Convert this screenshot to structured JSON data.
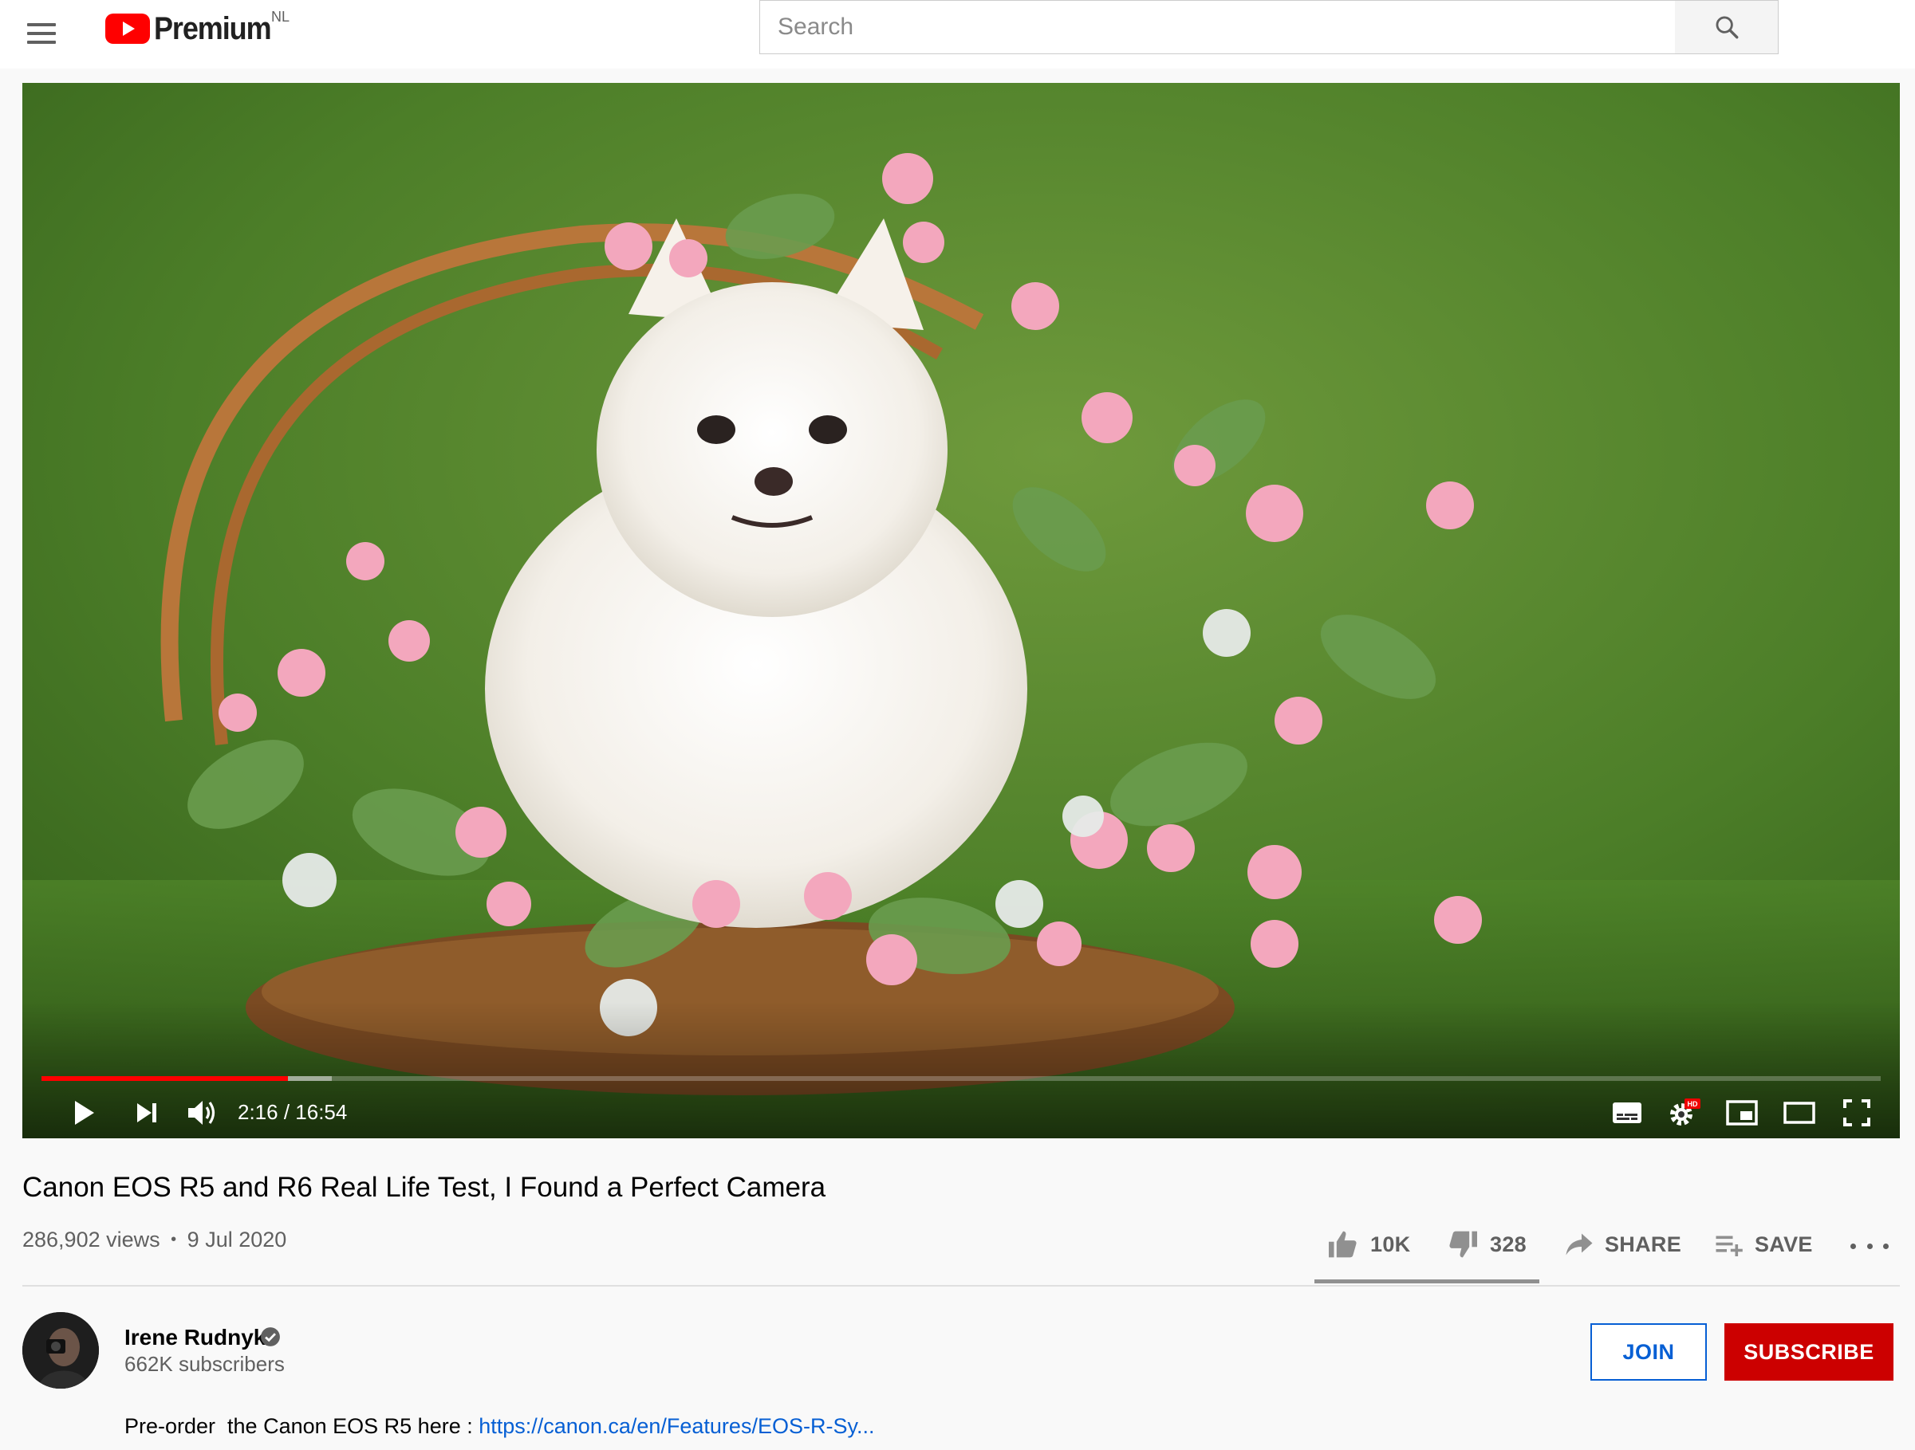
{
  "masthead": {
    "logo_text": "Premium",
    "country_code": "NL",
    "search_placeholder": "Search"
  },
  "player": {
    "current_time": "2:16",
    "duration": "16:54",
    "time_display": "2:16 / 16:54",
    "progress_played_fraction": 0.134,
    "progress_buffered_fraction": 0.158,
    "settings_badge": "HD",
    "accent_color": "#ff0000"
  },
  "video": {
    "title": "Canon EOS R5 and R6 Real Life Test, I Found a Perfect Camera",
    "views": "286,902 views",
    "separator": "•",
    "date": "9 Jul 2020",
    "likes": "10K",
    "dislikes": "328",
    "share_label": "SHARE",
    "save_label": "SAVE"
  },
  "channel": {
    "name": "Irene Rudnyk",
    "subscribers": "662K subscribers",
    "join_label": "JOIN",
    "subscribe_label": "SUBSCRIBE",
    "subscribe_color": "#cc0000",
    "join_color": "#065fd4"
  },
  "description": {
    "text": "Pre-order  the Canon EOS R5 here : ",
    "link": "https://canon.ca/en/Features/EOS-R-Sy..."
  }
}
